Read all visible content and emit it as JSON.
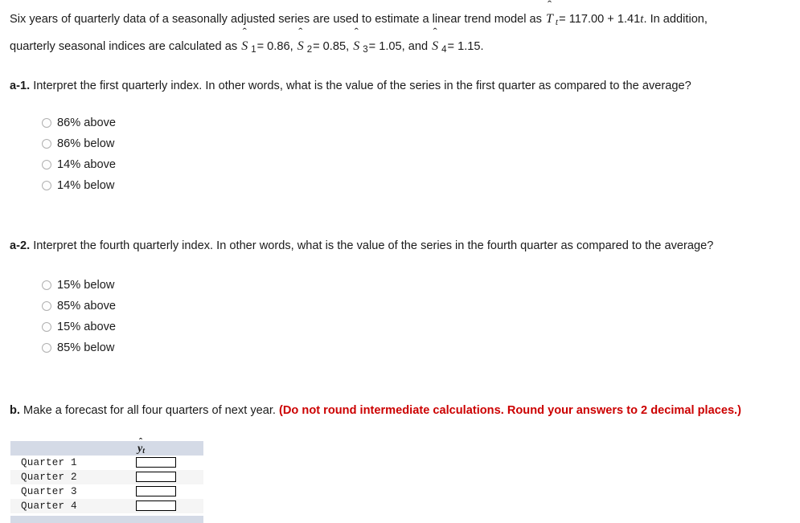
{
  "stem": {
    "line1_part1": "Six years of quarterly data of a seasonally adjusted series are used to estimate a linear trend model as",
    "trend_symbol": "T",
    "trend_subscript": "t",
    "trend_equation": "= 117.00 + 1.41",
    "trend_equation_var": "t",
    "trend_tail": ". In addition,",
    "line2_part1": "quarterly seasonal indices are calculated as",
    "seasonal_symbol": "S",
    "indices": [
      {
        "subscript": "1",
        "equals": "= 0.86,",
        "value": 0.86
      },
      {
        "subscript": "2",
        "equals": "= 0.85,",
        "value": 0.85
      },
      {
        "subscript": "3",
        "equals": "= 1.05, and",
        "value": 1.05
      },
      {
        "subscript": "4",
        "equals": "= 1.15.",
        "value": 1.15
      }
    ]
  },
  "question_a1": {
    "label": "a-1.",
    "text": "Interpret the first quarterly index. In other words, what is the value of the series in the first quarter as compared to the average?",
    "options": [
      "86% above",
      "86% below",
      "14% above",
      "14% below"
    ]
  },
  "question_a2": {
    "label": "a-2.",
    "text": "Interpret the fourth quarterly index. In other words, what is the value of the series in the fourth quarter as compared to the average?",
    "options": [
      "15% below",
      "85% above",
      "15% above",
      "85% below"
    ]
  },
  "question_b": {
    "label": "b.",
    "text": "Make a forecast for all four quarters of next year.",
    "instruction": "(Do not round intermediate calculations. Round your answers to 2 decimal places.)",
    "instruction_color": "#cc0000"
  },
  "answer_table": {
    "header_blank": "",
    "header_value_symbol": "y",
    "header_value_subscript": "t",
    "rows": [
      {
        "label": "Quarter 1",
        "value": ""
      },
      {
        "label": "Quarter 2",
        "value": ""
      },
      {
        "label": "Quarter 3",
        "value": ""
      },
      {
        "label": "Quarter 4",
        "value": ""
      }
    ]
  }
}
